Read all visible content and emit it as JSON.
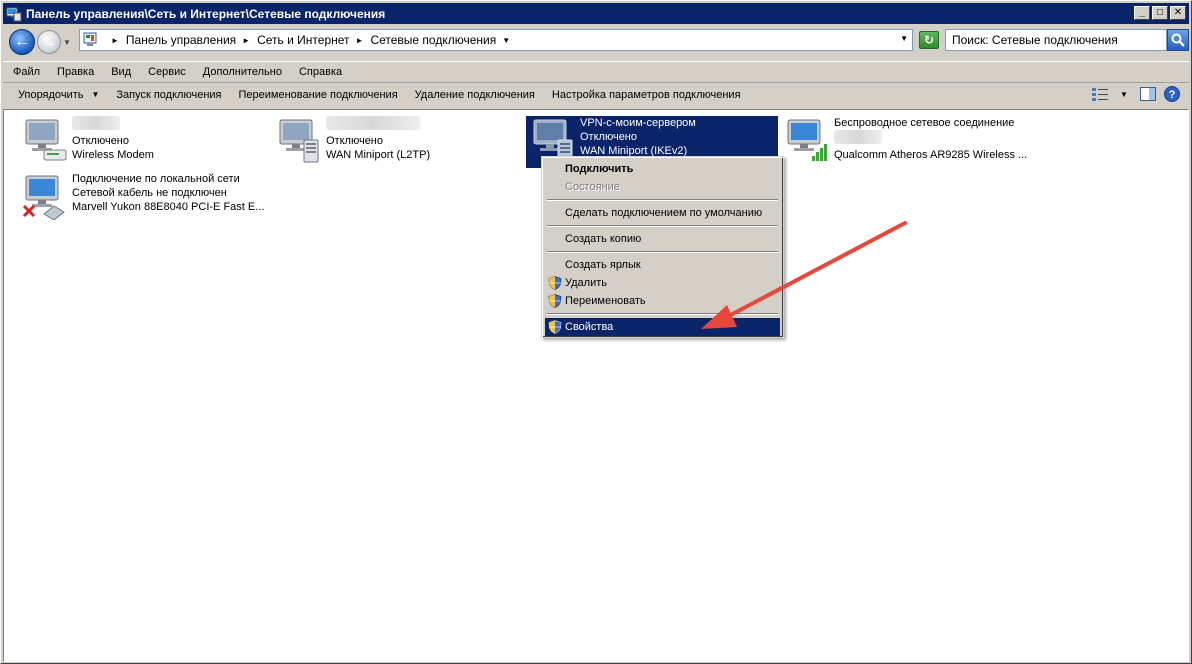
{
  "window": {
    "title": "Панель управления\\Сеть и Интернет\\Сетевые подключения",
    "buttons": {
      "minimize": "_",
      "maximize": "□",
      "close": "✕"
    }
  },
  "address": {
    "crumbs": [
      "Панель управления",
      "Сеть и Интернет",
      "Сетевые подключения"
    ],
    "search_placeholder": "Поиск: Сетевые подключения"
  },
  "menubar": [
    "Файл",
    "Правка",
    "Вид",
    "Сервис",
    "Дополнительно",
    "Справка"
  ],
  "toolbar": {
    "organize": "Упорядочить",
    "commands": [
      "Запуск подключения",
      "Переименование подключения",
      "Удаление подключения",
      "Настройка параметров подключения"
    ]
  },
  "connections": [
    {
      "name": "",
      "status": "Отключено",
      "device": "Wireless Modem",
      "icon": "modem-icon"
    },
    {
      "name": "",
      "status": "Отключено",
      "device": "WAN Miniport (L2TP)",
      "icon": "server-icon"
    },
    {
      "name": "VPN-с-моим-сервером",
      "status": "Отключено",
      "device": "WAN Miniport (IKEv2)",
      "icon": "server-icon",
      "selected": true
    },
    {
      "name": "Беспроводное сетевое соединение",
      "status": "",
      "device": "Qualcomm Atheros AR9285 Wireless ...",
      "icon": "wireless-signal-icon"
    },
    {
      "name": "Подключение по локальной сети",
      "status": "Сетевой кабель не подключен",
      "device": "Marvell Yukon 88E8040 PCI-E Fast E...",
      "icon": "ethernet-disconnected-icon"
    }
  ],
  "context_menu": {
    "items": [
      {
        "label": "Подключить",
        "style": "bold"
      },
      {
        "label": "Состояние",
        "style": "disabled"
      },
      {
        "label": "Сделать подключением по умолчанию"
      },
      {
        "label": "Создать копию"
      },
      {
        "label": "Создать ярлык"
      },
      {
        "label": "Удалить",
        "shield": true
      },
      {
        "label": "Переименовать",
        "shield": true
      },
      {
        "label": "Свойства",
        "shield": true,
        "highlighted": true
      }
    ]
  },
  "colors": {
    "selection": "#0a246a",
    "annotation_arrow": "#e8473a",
    "window_face": "#d4d0c8"
  }
}
